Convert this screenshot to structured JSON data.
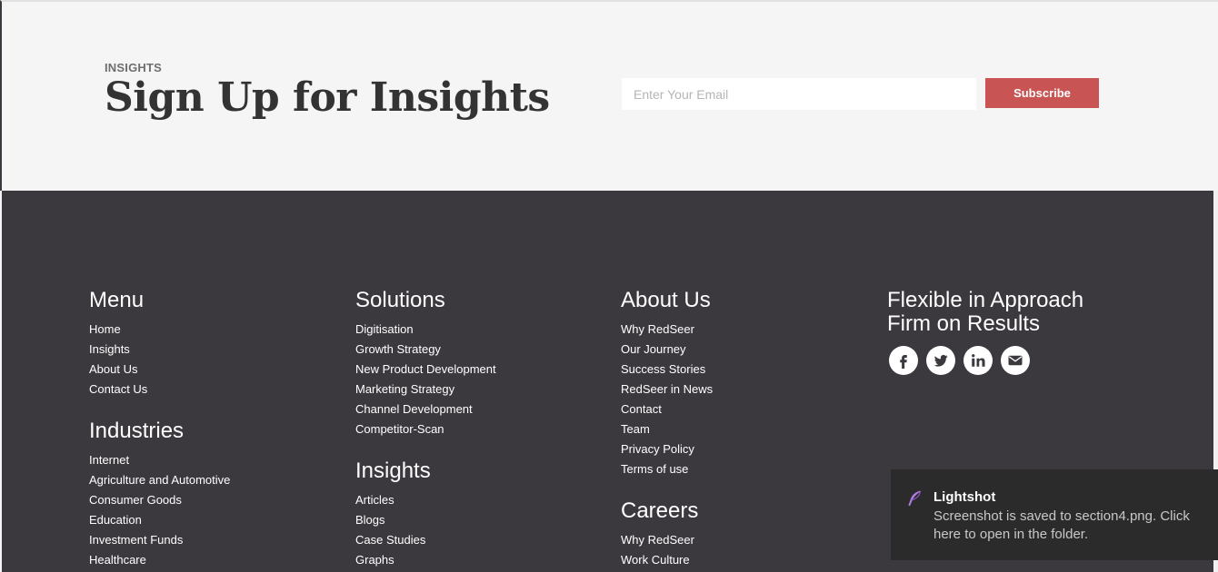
{
  "signup": {
    "eyebrow": "INSIGHTS",
    "title": "Sign Up for Insights",
    "email_placeholder": "Enter Your Email",
    "subscribe_label": "Subscribe"
  },
  "footer": {
    "menu": {
      "title": "Menu",
      "items": [
        "Home",
        "Insights",
        "About Us",
        "Contact Us"
      ]
    },
    "industries": {
      "title": "Industries",
      "items": [
        "Internet",
        "Agriculture and Automotive",
        "Consumer Goods",
        "Education",
        "Investment Funds",
        "Healthcare"
      ]
    },
    "solutions": {
      "title": "Solutions",
      "items": [
        "Digitisation",
        "Growth Strategy",
        "New Product Development",
        "Marketing Strategy",
        "Channel Development",
        "Competitor-Scan"
      ]
    },
    "insights": {
      "title": "Insights",
      "items": [
        "Articles",
        "Blogs",
        "Case Studies",
        "Graphs"
      ]
    },
    "about": {
      "title": "About Us",
      "items": [
        "Why RedSeer",
        "Our Journey",
        "Success Stories",
        "RedSeer in News",
        "Contact",
        "Team",
        "Privacy Policy",
        "Terms of use"
      ]
    },
    "careers": {
      "title": "Careers",
      "items": [
        "Why RedSeer",
        "Work Culture"
      ]
    },
    "tagline": {
      "line1": "Flexible in Approach",
      "line2": "Firm on Results"
    },
    "social_icons": [
      "facebook-icon",
      "twitter-icon",
      "linkedin-icon",
      "email-icon"
    ]
  },
  "toast": {
    "app": "Lightshot",
    "message": "Screenshot is saved to section4.png. Click here to open in the folder."
  },
  "colors": {
    "accent": "#c95454",
    "footer_bg": "#3b383e",
    "signup_bg": "#f5f5f5",
    "toast_bg": "#2b2b2b"
  }
}
